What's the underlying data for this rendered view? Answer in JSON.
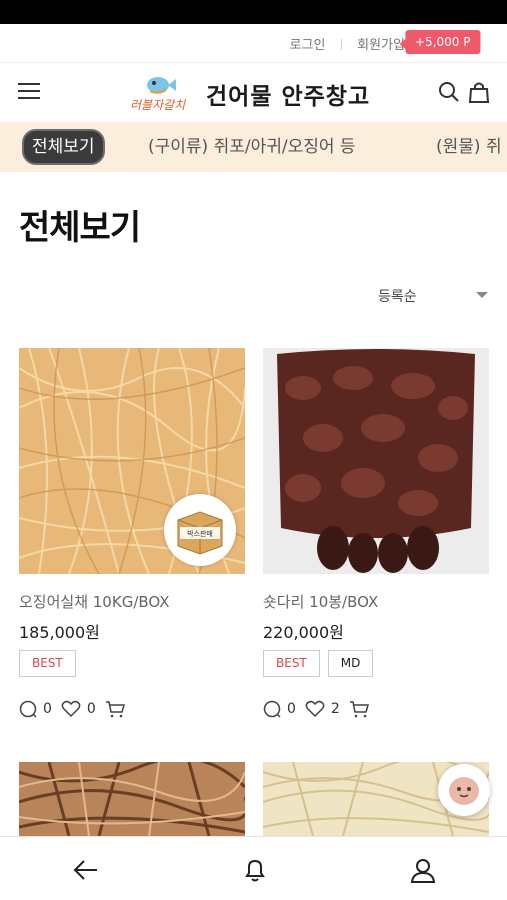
{
  "auth": {
    "login": "로그인",
    "signup": "회원가입",
    "point_badge": "+5,000 P"
  },
  "header": {
    "logo_text": "건어물 안주창고",
    "logo_script": "러블자갈치"
  },
  "categories": [
    {
      "label": "전체보기",
      "active": true
    },
    {
      "label": "(구이류) 쥐포/아귀/오징어 등",
      "active": false
    },
    {
      "label": "(원물) 쥐",
      "active": false
    }
  ],
  "page": {
    "title": "전체보기",
    "sort_label": "등록순"
  },
  "products": [
    {
      "name": "오징어실채 10KG/BOX",
      "price": "185,000원",
      "badges": [
        "BEST"
      ],
      "reviews": "0",
      "likes": "0",
      "sticker": "박스판매"
    },
    {
      "name": "숏다리 10봉/BOX",
      "price": "220,000원",
      "badges": [
        "BEST",
        "MD"
      ],
      "reviews": "0",
      "likes": "2"
    }
  ],
  "colors": {
    "accent": "#ef5a6a",
    "category_bar": "#fbeedd",
    "best_text": "#e1454e"
  }
}
